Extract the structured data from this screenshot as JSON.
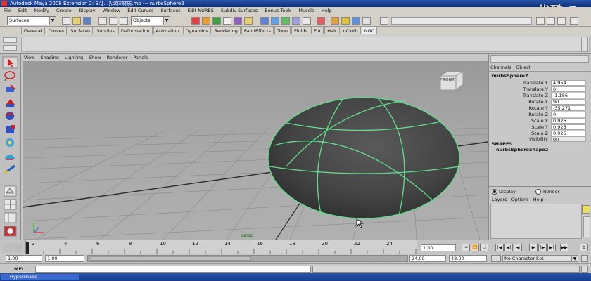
{
  "window": {
    "title": "Autodesk Maya 2008 Extension 2: E:\\[...]\\球体材质.mb   ---   nurbsSphere2"
  },
  "watermark": {
    "text": "优酷"
  },
  "menu": [
    "File",
    "Edit",
    "Modify",
    "Create",
    "Display",
    "Window",
    "Edit Curves",
    "Surfaces",
    "Edit NURBS",
    "Subdiv Surfaces",
    "Bonus Tools",
    "Muscle",
    "Help"
  ],
  "status": {
    "menuset": "Surfaces",
    "selection_mode": "Objects"
  },
  "shelf_tabs": [
    "General",
    "Curves",
    "Surfaces",
    "Subdivs",
    "Deformation",
    "Animation",
    "Dynamics",
    "Rendering",
    "PaintEffects",
    "Toon",
    "Fluids",
    "Fur",
    "Hair",
    "nCloth",
    "NGC"
  ],
  "shelf_active": "NGC",
  "viewport": {
    "menu": [
      "View",
      "Shading",
      "Lighting",
      "Show",
      "Renderer",
      "Panels"
    ],
    "camera_label": "persp",
    "viewcube_label": "FRONT"
  },
  "channel_box": {
    "tabs": [
      "Channels",
      "Object"
    ],
    "object_name": "nurbsSphere2",
    "attributes": [
      {
        "label": "Translate X",
        "value": "4.954"
      },
      {
        "label": "Translate Y",
        "value": "0"
      },
      {
        "label": "Translate Z",
        "value": "-1.186"
      },
      {
        "label": "Rotate X",
        "value": "90"
      },
      {
        "label": "Rotate Y",
        "value": "-35.271"
      },
      {
        "label": "Rotate Z",
        "value": "0"
      },
      {
        "label": "Scale X",
        "value": "0.926"
      },
      {
        "label": "Scale Y",
        "value": "0.926"
      },
      {
        "label": "Scale Z",
        "value": "0.926"
      },
      {
        "label": "Visibility",
        "value": "on"
      }
    ],
    "shapes_label": "SHAPES",
    "shape_name": "nurbsSphereShape2"
  },
  "layer_editor": {
    "display_label": "Display",
    "render_label": "Render",
    "menu": [
      "Layers",
      "Options",
      "Help"
    ]
  },
  "time_slider": {
    "ticks": [
      "2",
      "4",
      "6",
      "8",
      "10",
      "12",
      "14",
      "16",
      "18",
      "20",
      "22",
      "24"
    ],
    "current_frame": "1.00"
  },
  "range_slider": {
    "start_time": "1.00",
    "playback_start": "1.00",
    "playback_end": "24.00",
    "end_time": "48.00",
    "character_set": "No Character Set"
  },
  "command_line": {
    "label": "MEL"
  },
  "taskbar": {
    "item": "Hypershade"
  },
  "colors": {
    "wireframe": "#5fe08a",
    "sphere": "#4a4a4a",
    "viewport_top": "#9a9a9a",
    "title_blue": "#1b3f8f"
  }
}
